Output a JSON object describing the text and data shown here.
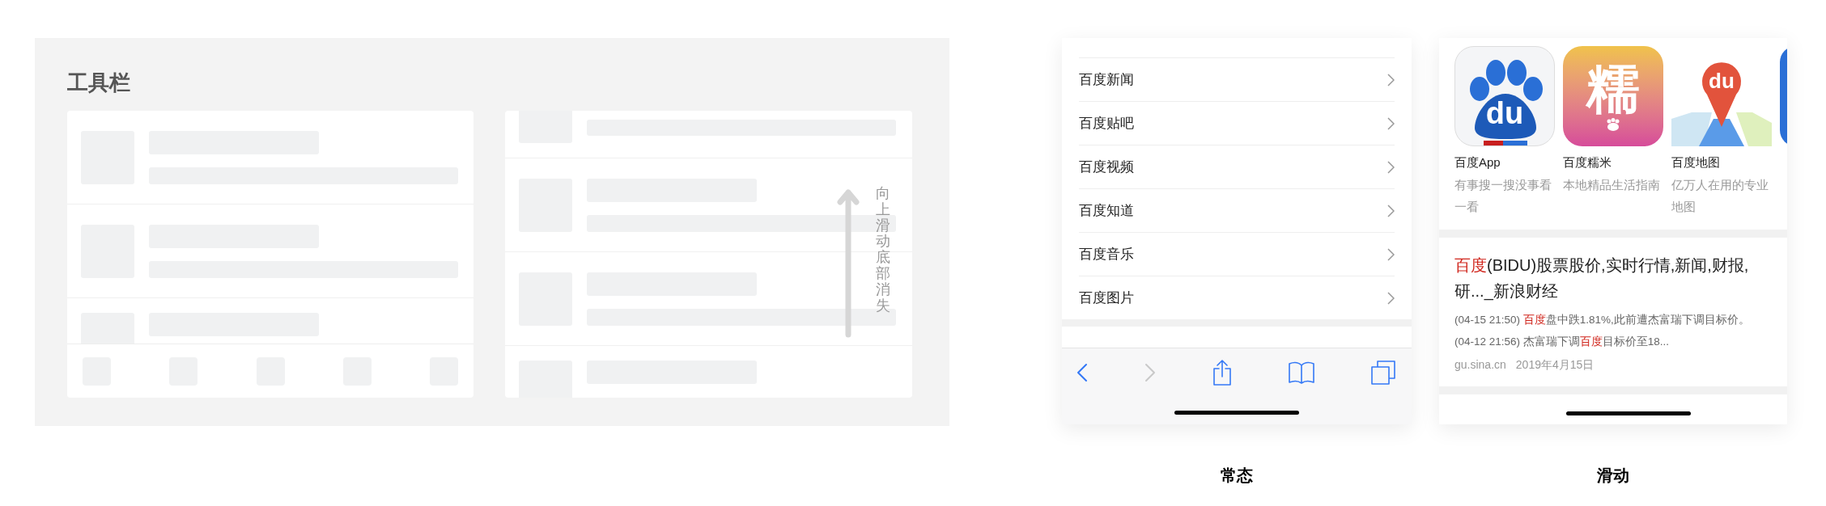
{
  "toolbar_demo": {
    "title": "工具栏",
    "scroll_hint": "向上滑动底部消失"
  },
  "phones": [
    {
      "kind": "list",
      "caption": "常态",
      "items": [
        {
          "label": "百度新闻"
        },
        {
          "label": "百度贴吧"
        },
        {
          "label": "百度视频"
        },
        {
          "label": "百度知道"
        },
        {
          "label": "百度音乐"
        },
        {
          "label": "百度图片"
        }
      ],
      "toolbar": [
        {
          "kind": "back",
          "disabled": false
        },
        {
          "kind": "forward",
          "disabled": true
        },
        {
          "kind": "share",
          "disabled": false
        },
        {
          "kind": "bookmarks",
          "disabled": false
        },
        {
          "kind": "tabs",
          "disabled": false
        }
      ]
    },
    {
      "kind": "feed",
      "caption": "滑动",
      "apps": [
        {
          "kind": "paw",
          "icon_text": "du",
          "name": "百度App",
          "description": "有事搜一搜没事看一看"
        },
        {
          "kind": "glyph",
          "icon_text": "糯",
          "name": "百度糯米",
          "description": "本地精品生活指南"
        },
        {
          "kind": "pin",
          "icon_text": "du",
          "name": "百度地图",
          "description": "亿万人在用的专业地图"
        }
      ],
      "news": {
        "title": [
          {
            "text": "百度",
            "highlight": true
          },
          {
            "text": "(BIDU)股票股价,实时行情,新闻,财报,研..._新浪财经",
            "highlight": false
          }
        ],
        "snippet": [
          {
            "text": "(04-15 21:50) ",
            "highlight": false
          },
          {
            "text": "百度",
            "highlight": true
          },
          {
            "text": "盘中跌1.81%,此前遭杰富瑞下调目标价。 (04-12 21:56) 杰富瑞下调",
            "highlight": false
          },
          {
            "text": "百度",
            "highlight": true
          },
          {
            "text": "目标价至18...",
            "highlight": false
          }
        ],
        "source": "gu.sina.cn",
        "date": "2019年4月15日"
      }
    }
  ]
}
